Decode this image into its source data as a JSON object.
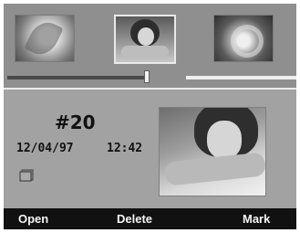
{
  "thumbnail_strip": {
    "thumbnails": [
      {
        "subject": "flower"
      },
      {
        "subject": "girl portrait",
        "selected": true
      },
      {
        "subject": "flower close-up"
      }
    ]
  },
  "details": {
    "number": "#20",
    "date": "12/04/97",
    "time": "12:42",
    "memo_icon": "memo-icon"
  },
  "softkeys": {
    "open": "Open",
    "delete": "Delete",
    "mark": "Mark"
  },
  "colors": {
    "screen_bg": "#9a9a9a",
    "softkey_bar": "#111111",
    "softkey_text": "#f5f5f5"
  }
}
